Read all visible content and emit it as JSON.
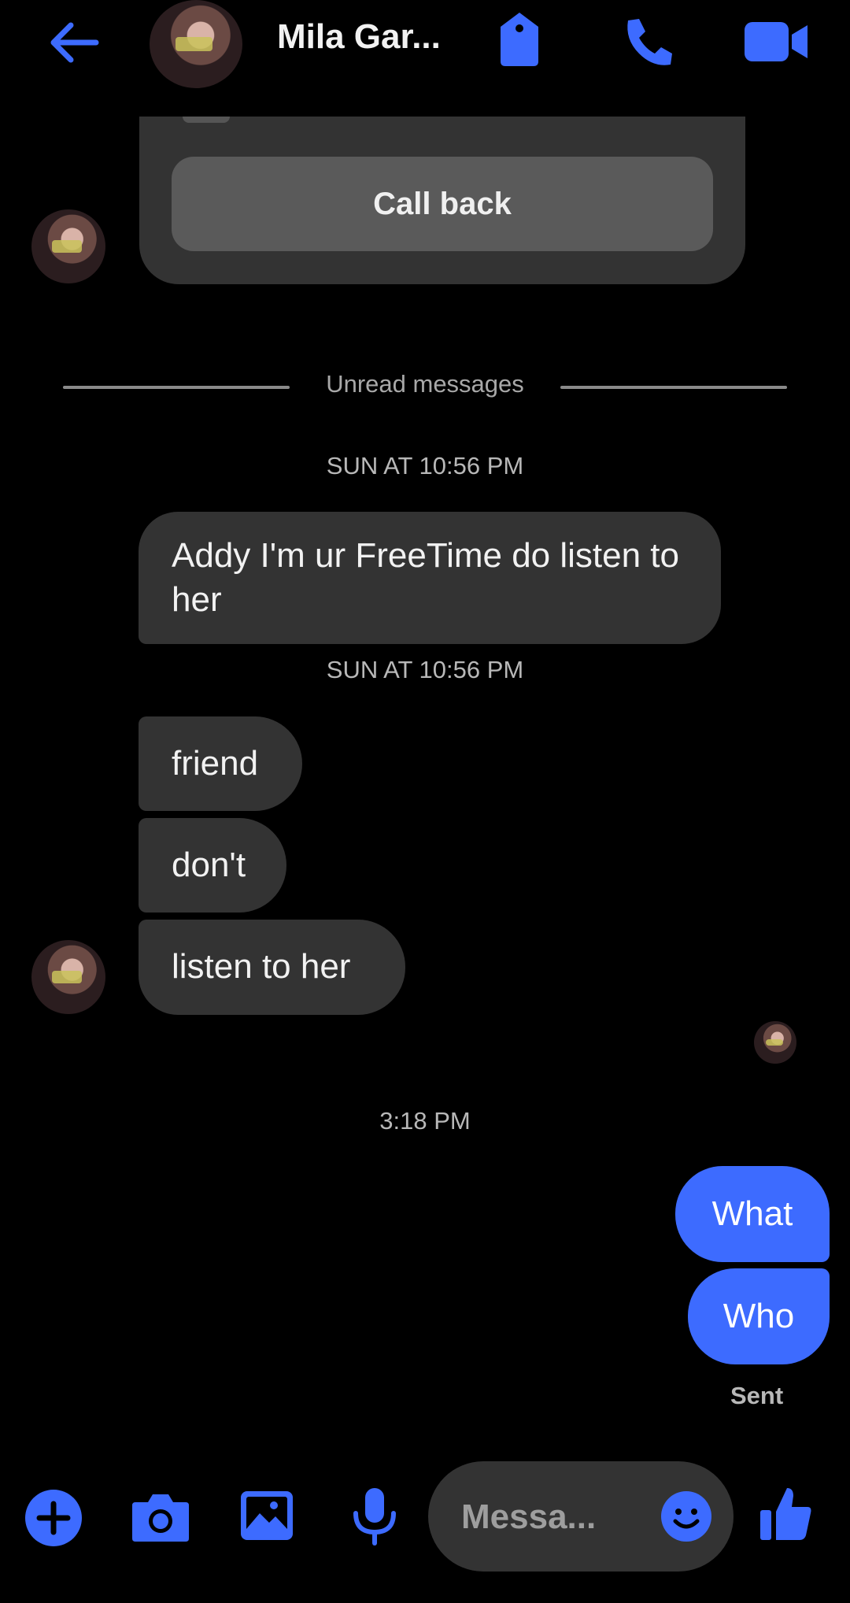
{
  "header": {
    "contact_name": "Mila Gar...",
    "icons": [
      "back-arrow-icon",
      "tag-icon",
      "phone-icon",
      "video-icon"
    ]
  },
  "call_card": {
    "button_label": "Call back"
  },
  "divider": {
    "label": "Unread messages"
  },
  "messages": {
    "timestamp_1": "SUN AT 10:56 PM",
    "incoming_1": "Addy I'm ur FreeTime do listen to her",
    "timestamp_2": "SUN AT 10:56 PM",
    "incoming_2": "friend",
    "incoming_3": "don't",
    "incoming_4": "listen to her",
    "timestamp_3": "3:18 PM",
    "outgoing_1": "What",
    "outgoing_2": "Who",
    "status": "Sent"
  },
  "composer": {
    "placeholder": "Messa...",
    "icons": [
      "plus-icon",
      "camera-icon",
      "gallery-icon",
      "microphone-icon",
      "emoji-icon",
      "thumbs-up-icon"
    ]
  },
  "colors": {
    "accent": "#3d6bff",
    "bubble_incoming": "#333333",
    "background": "#000000"
  }
}
